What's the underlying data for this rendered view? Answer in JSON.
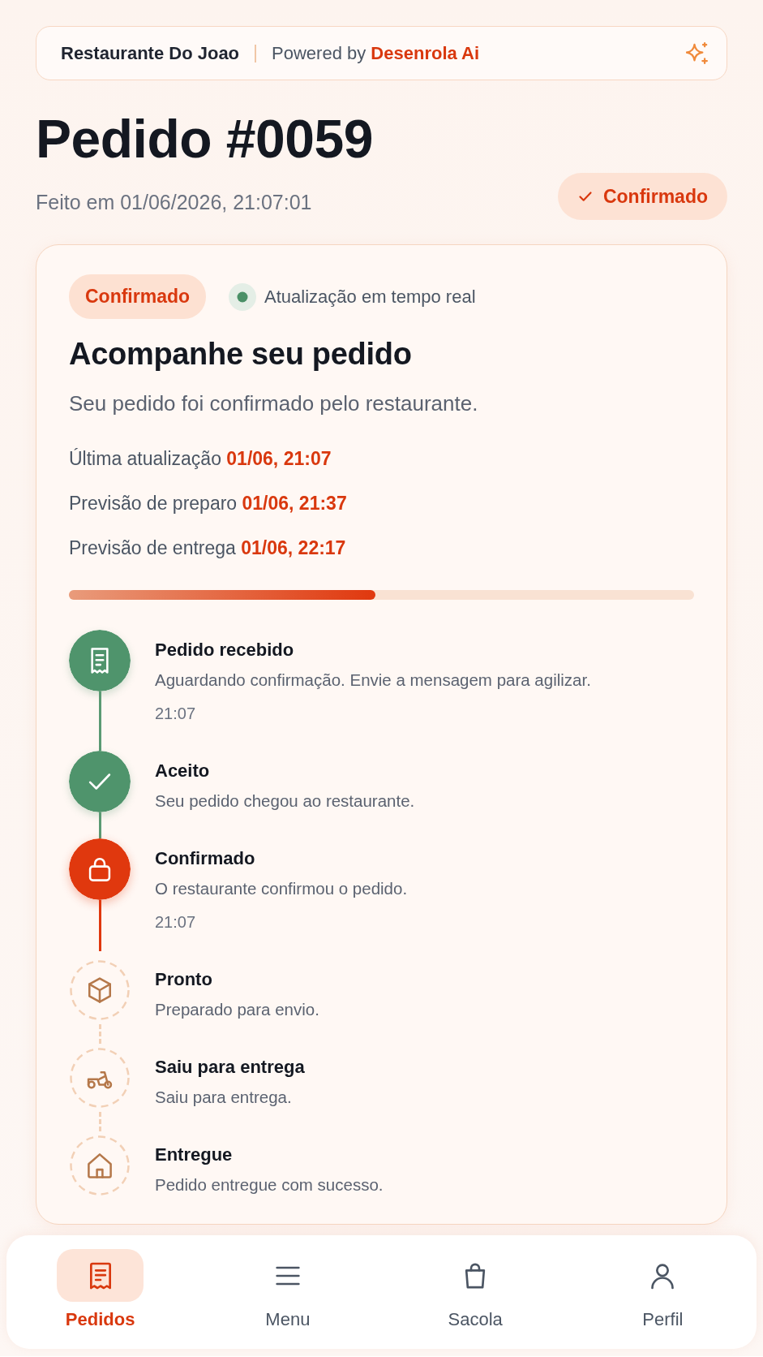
{
  "header": {
    "restaurant": "Restaurante Do Joao",
    "powered_by": "Powered by **Desenrola Ai**"
  },
  "order": {
    "title": "Pedido #0059",
    "placed_at": "Feito em 01/06/2026, 21:07:01",
    "status": "Confirmado"
  },
  "tracking": {
    "badge": "Confirmado",
    "live_label": "Atualização em tempo real",
    "heading": "Acompanhe seu pedido",
    "subtitle": "Seu pedido foi confirmado pelo restaurante.",
    "info": [
      {
        "label": "Última atualização",
        "value": "01/06, 21:07"
      },
      {
        "label": "Previsão de preparo",
        "value": "01/06, 21:37"
      },
      {
        "label": "Previsão de entrega",
        "value": "01/06, 22:17"
      }
    ],
    "progress": {
      "level": 0.49
    },
    "steps": [
      {
        "title": "Pedido recebido",
        "description": "Aguardando confirmação. Envie a mensagem para agilizar.",
        "time": "21:07",
        "kind": "done"
      },
      {
        "title": "Aceito",
        "description": "Seu pedido chegou ao restaurante.",
        "kind": "done"
      },
      {
        "title": "Confirmado",
        "description": "O restaurante confirmou o pedido.",
        "time": "21:07",
        "kind": "current"
      },
      {
        "title": "Pronto",
        "description": "Preparado para envio.",
        "kind": "pending"
      },
      {
        "title": "Saiu para entrega",
        "description": "Saiu para entrega.",
        "kind": "pending"
      },
      {
        "title": "Entregue",
        "description": "Pedido entregue com sucesso.",
        "kind": "pending"
      }
    ]
  },
  "nav": [
    {
      "label": "Pedidos",
      "selected": true
    },
    {
      "label": "Menu",
      "selected": false
    },
    {
      "label": "Sacola",
      "selected": false
    },
    {
      "label": "Perfil",
      "selected": false
    }
  ]
}
